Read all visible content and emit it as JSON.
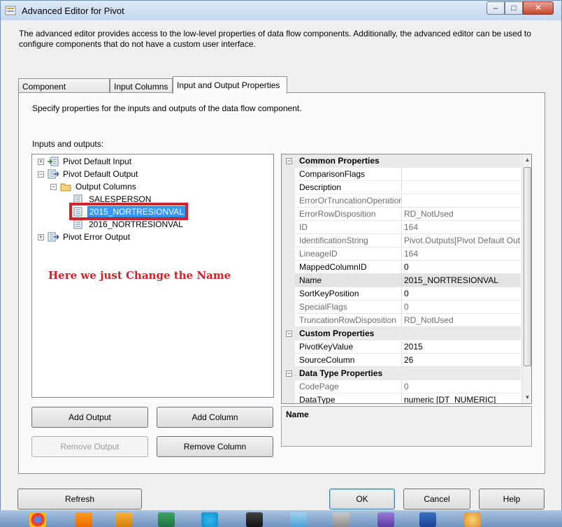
{
  "window": {
    "title": "Advanced Editor for Pivot",
    "min_glyph": "–",
    "max_glyph": "□",
    "close_glyph": "✕"
  },
  "intro": "The advanced editor provides access to the low-level properties of data flow components. Additionally, the advanced editor can be used to configure components that do not have a custom user interface.",
  "tabs": [
    {
      "label": "Component Properties",
      "active": false
    },
    {
      "label": "Input Columns",
      "active": false
    },
    {
      "label": "Input and Output Properties",
      "active": true
    }
  ],
  "panel": {
    "description": "Specify properties for the inputs and outputs of the data flow component.",
    "io_label": "Inputs and outputs:"
  },
  "tree": [
    {
      "label": "Pivot Default Input",
      "expander": "+"
    },
    {
      "label": "Pivot Default Output",
      "expander": "−"
    },
    {
      "label": "Output Columns",
      "expander": "−"
    },
    {
      "label": "SALESPERSON"
    },
    {
      "label": "2015_NORTRESIONVAL",
      "selected": true
    },
    {
      "label": "2016_NORTRESIONVAL"
    },
    {
      "label": "Pivot Error Output",
      "expander": "+"
    }
  ],
  "annotation": "Here we just Change the Name",
  "properties": [
    {
      "category": "Common Properties"
    },
    {
      "name": "ComparisonFlags",
      "value": "",
      "readonly": false
    },
    {
      "name": "Description",
      "value": "",
      "readonly": false
    },
    {
      "name": "ErrorOrTruncationOperation",
      "value": "",
      "readonly": true
    },
    {
      "name": "ErrorRowDisposition",
      "value": "RD_NotUsed",
      "readonly": true
    },
    {
      "name": "ID",
      "value": "164",
      "readonly": true
    },
    {
      "name": "IdentificationString",
      "value": "Pivot.Outputs[Pivot Default Output]",
      "readonly": true
    },
    {
      "name": "LineageID",
      "value": "164",
      "readonly": true
    },
    {
      "name": "MappedColumnID",
      "value": "0",
      "readonly": false
    },
    {
      "name": "Name",
      "value": "2015_NORTRESIONVAL",
      "readonly": false,
      "selected": true
    },
    {
      "name": "SortKeyPosition",
      "value": "0",
      "readonly": false
    },
    {
      "name": "SpecialFlags",
      "value": "0",
      "readonly": true
    },
    {
      "name": "TruncationRowDisposition",
      "value": "RD_NotUsed",
      "readonly": true
    },
    {
      "category": "Custom Properties"
    },
    {
      "name": "PivotKeyValue",
      "value": "2015",
      "readonly": false
    },
    {
      "name": "SourceColumn",
      "value": "26",
      "readonly": false
    },
    {
      "category": "Data Type Properties"
    },
    {
      "name": "CodePage",
      "value": "0",
      "readonly": true
    },
    {
      "name": "DataType",
      "value": "numeric [DT_NUMERIC]",
      "readonly": false
    }
  ],
  "description_box_title": "Name",
  "buttons": {
    "add_output": "Add Output",
    "add_column": "Add Column",
    "remove_output": "Remove Output",
    "remove_column": "Remove Column",
    "refresh": "Refresh",
    "ok": "OK",
    "cancel": "Cancel",
    "help": "Help"
  },
  "colors": {
    "annotation_red": "#d2232a",
    "selection_blue": "#3399ff"
  },
  "taskbar_icons": [
    "chrome-icon",
    "vlc-icon",
    "media-player-icon",
    "excel-icon",
    "skype-icon",
    "visual-studio-icon",
    "notepad-icon",
    "ssis-icon",
    "word-icon",
    "paint-icon"
  ]
}
